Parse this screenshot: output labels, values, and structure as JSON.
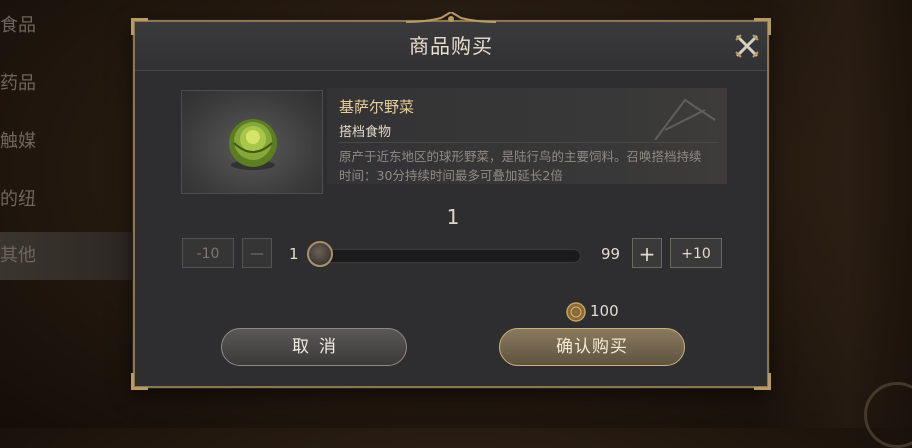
{
  "background_menu": {
    "items": [
      {
        "label": "食品"
      },
      {
        "label": "药品"
      },
      {
        "label": "触媒"
      },
      {
        "label": "的纽"
      },
      {
        "label": "其他"
      }
    ]
  },
  "dialog": {
    "title": "商品购买",
    "close_icon": "close-x-icon"
  },
  "item": {
    "name": "基萨尔野菜",
    "category": "搭档食物",
    "description": "原产于近东地区的球形野菜，是陆行鸟的主要饲料。召唤搭档持续时间：30分持续时间最多可叠加延长2倍",
    "icon": "green-vegetable-icon"
  },
  "quantity": {
    "current": "1",
    "min": "1",
    "max": "99",
    "minus10_label": "-10",
    "minus_label": "—",
    "plus_label": "+",
    "plus10_label": "+10",
    "fraction": 0.0
  },
  "price": {
    "amount": "100",
    "icon": "coin-icon"
  },
  "buttons": {
    "cancel_label": "取消",
    "confirm_label": "确认购买"
  },
  "colors": {
    "accent_gold": "#b89a64",
    "title_text": "#e9dfcf",
    "item_name": "#e6cf9a"
  }
}
